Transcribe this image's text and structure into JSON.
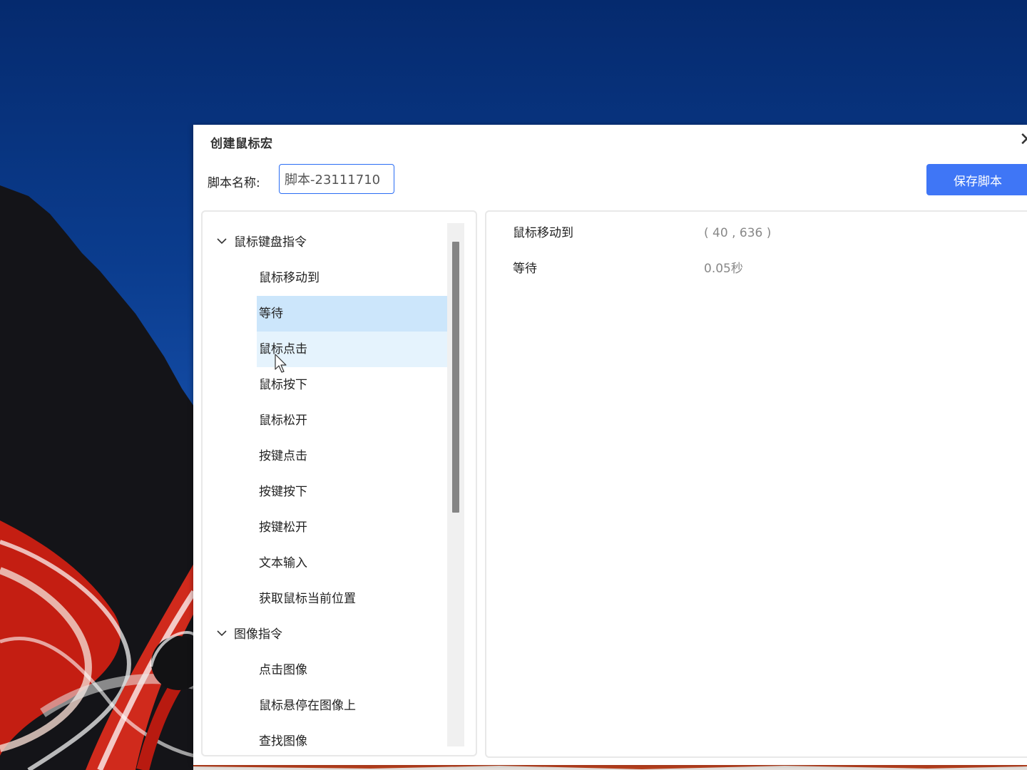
{
  "dialog": {
    "title": "创建鼠标宏",
    "close_label": "✕"
  },
  "script_name": {
    "label": "脚本名称:",
    "value": "脚本-23111710"
  },
  "toolbar": {
    "save_label": "保存脚本"
  },
  "command_tree": {
    "groups": [
      {
        "label": "鼠标键盘指令",
        "items": [
          {
            "label": "鼠标移动到"
          },
          {
            "label": "等待"
          },
          {
            "label": "鼠标点击"
          },
          {
            "label": "鼠标按下"
          },
          {
            "label": "鼠标松开"
          },
          {
            "label": "按键点击"
          },
          {
            "label": "按键按下"
          },
          {
            "label": "按键松开"
          },
          {
            "label": "文本输入"
          },
          {
            "label": "获取鼠标当前位置"
          }
        ]
      },
      {
        "label": "图像指令",
        "items": [
          {
            "label": "点击图像"
          },
          {
            "label": "鼠标悬停在图像上"
          },
          {
            "label": "查找图像"
          }
        ]
      }
    ],
    "selected_item": "等待",
    "hovered_item": "鼠标点击"
  },
  "script_steps": [
    {
      "name": "鼠标移动到",
      "value": "( 40 , 636 )"
    },
    {
      "name": "等待",
      "value": "0.05秒"
    }
  ],
  "colors": {
    "accent": "#3f76f6",
    "selected_row": "#cce6fb",
    "hover_row": "#e5f3fd",
    "value_text": "#888888"
  }
}
